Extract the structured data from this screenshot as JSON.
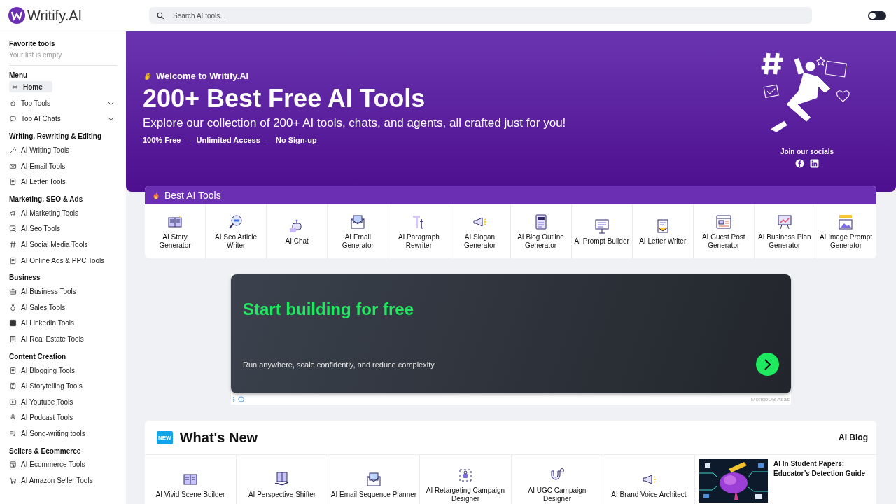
{
  "brand": {
    "name": "Writify.AI"
  },
  "search": {
    "placeholder": "Search AI tools..."
  },
  "theme_toggle": {
    "on": false
  },
  "sidebar": {
    "favorites": {
      "title": "Favorite tools",
      "empty_text": "Your list is empty"
    },
    "sections": [
      {
        "title": "Menu",
        "items": [
          {
            "label": "Home",
            "kind": "link",
            "selected": true
          },
          {
            "label": "Top Tools",
            "kind": "dropdown",
            "selected": false,
            "expanded": false
          },
          {
            "label": "Top AI Chats",
            "kind": "dropdown",
            "selected": false,
            "expanded": false
          }
        ]
      },
      {
        "title": "Writing, Rewriting & Editing",
        "items": [
          {
            "label": "AI Writing Tools",
            "kind": "link",
            "selected": false
          },
          {
            "label": "AI Email Tools",
            "kind": "link",
            "selected": false
          },
          {
            "label": "AI Letter Tools",
            "kind": "link",
            "selected": false
          }
        ]
      },
      {
        "title": "Marketing, SEO & Ads",
        "items": [
          {
            "label": "AI Marketing Tools",
            "kind": "link",
            "selected": false
          },
          {
            "label": "AI Seo Tools",
            "kind": "link",
            "selected": false
          },
          {
            "label": "AI Social Media Tools",
            "kind": "link",
            "selected": false
          },
          {
            "label": "AI Online Ads & PPC Tools",
            "kind": "link",
            "selected": false
          }
        ]
      },
      {
        "title": "Business",
        "items": [
          {
            "label": "AI Business Tools",
            "kind": "link",
            "selected": false
          },
          {
            "label": "AI Sales Tools",
            "kind": "link",
            "selected": false
          },
          {
            "label": "AI LinkedIn Tools",
            "kind": "link",
            "selected": false
          },
          {
            "label": "AI Real Estate Tools",
            "kind": "link",
            "selected": false
          }
        ]
      },
      {
        "title": "Content Creation",
        "items": [
          {
            "label": "AI Blogging Tools",
            "kind": "link",
            "selected": false
          },
          {
            "label": "AI Storytelling Tools",
            "kind": "link",
            "selected": false
          },
          {
            "label": "AI Youtube Tools",
            "kind": "link",
            "selected": false
          },
          {
            "label": "AI Podcast Tools",
            "kind": "link",
            "selected": false
          },
          {
            "label": "AI Song-writing tools",
            "kind": "link",
            "selected": false
          }
        ]
      },
      {
        "title": "Sellers & Ecommerce",
        "items": [
          {
            "label": "AI Ecommerce Tools",
            "kind": "link",
            "selected": false
          },
          {
            "label": "AI Amazon Seller Tools",
            "kind": "link",
            "selected": false
          }
        ]
      }
    ]
  },
  "hero": {
    "greeting": "Welcome to Writify.AI",
    "title": "200+ Best Free AI Tools",
    "subtitle": "Explore our collection of 200+ AI tools, chats, and agents, all crafted just for you!",
    "features": [
      "100% Free",
      "Unlimited Access",
      "No Sign-up"
    ],
    "separator": "–",
    "socials_title": "Join our socials"
  },
  "best_tools": {
    "title": "Best AI Tools",
    "tiles": [
      "AI Story Generator",
      "AI Seo Article Writer",
      "AI Chat",
      "AI Email Generator",
      "AI Paragraph Rewriter",
      "AI Slogan Generator",
      "AI Blog Outline Generator",
      "AI Prompt Builder",
      "AI Letter Writer",
      "AI Guest Post Generator",
      "AI Business Plan Generator",
      "AI Image Prompt Generator"
    ]
  },
  "ad": {
    "title": "Start building for free",
    "text": "Run anywhere, scale confidently, and reduce complexity.",
    "sponsor": "MongoDB Atlas"
  },
  "whats_new": {
    "badge": "NEW",
    "title": "What's New",
    "link": "AI Blog",
    "tiles": [
      "AI Vivid Scene Builder",
      "AI Perspective Shifter",
      "AI Email Sequence Planner",
      "AI Retargeting Campaign Designer",
      "AI UGC Campaign Designer",
      "AI Brand Voice Architect"
    ],
    "blog_post": {
      "kind": "picture",
      "title": "AI In Student Papers: Educator’s Detection Guide"
    }
  }
}
